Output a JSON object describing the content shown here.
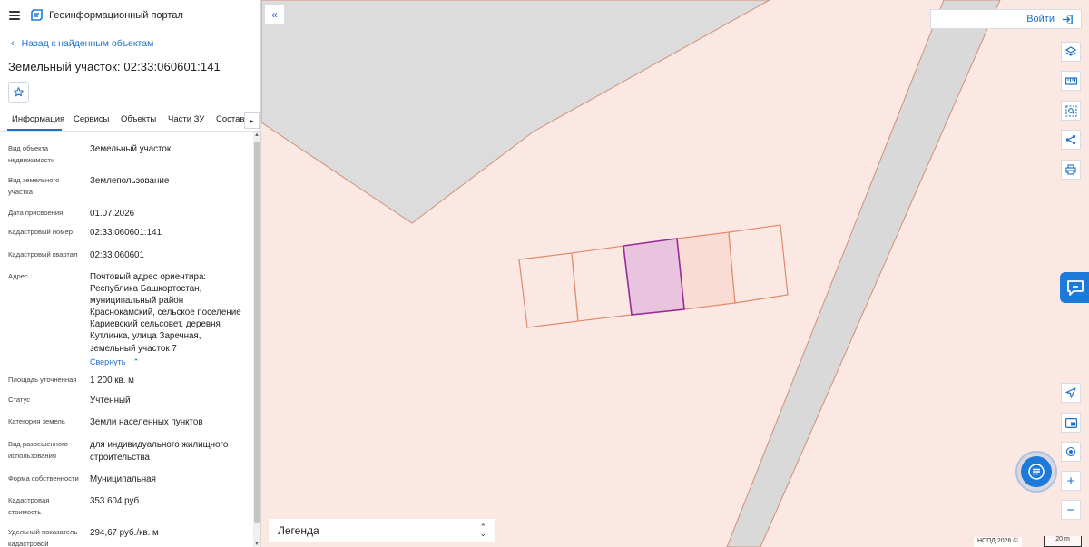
{
  "header": {
    "portal_title": "Геоинформационный портал"
  },
  "nav": {
    "back_label": "Назад к найденным объектам"
  },
  "object": {
    "title": "Земельный участок: 02:33:060601:141"
  },
  "tabs": [
    {
      "label": "Информация",
      "active": true
    },
    {
      "label": "Сервисы"
    },
    {
      "label": "Объекты"
    },
    {
      "label": "Части ЗУ"
    },
    {
      "label": "Состав"
    }
  ],
  "properties": [
    {
      "label": "Вид объекта недвижимости",
      "value": "Земельный участок"
    },
    {
      "label": "Вид земельного участка",
      "value": "Землепользование"
    },
    {
      "label": "Дата присвоения",
      "value": "01.07.2026"
    },
    {
      "label": "Кадастровый номер",
      "value": "02:33:060601:141"
    },
    {
      "label": "Кадастровый квартал",
      "value": "02:33:060601"
    },
    {
      "label": "Адрес",
      "value": "Почтовый адрес ориентира: Республика Башкортостан, муниципальный район Краснокамский, сельское поселение Кариевский сельсовет, деревня Кутлинка, улица Заречная, земельный участок 7",
      "link": "Свернуть"
    },
    {
      "label": "Площадь уточненная",
      "value": "1 200 кв. м"
    },
    {
      "label": "Статус",
      "value": "Учтенный"
    },
    {
      "label": "Категория земель",
      "value": "Земли населенных пунктов"
    },
    {
      "label": "Вид разрешенного использования",
      "value": "для индивидуального жилищного строительства"
    },
    {
      "label": "Форма собственности",
      "value": "Муниципальная"
    },
    {
      "label": "Кадастровая стоимость",
      "value": "353 604 руб."
    },
    {
      "label": "Удельный показатель кадастровой",
      "value": "294,67 руб./кв. м"
    }
  ],
  "map": {
    "login_label": "Войти",
    "legend_label": "Легенда",
    "attribution": "НСПД 2026 ©",
    "scale_label": "20 m",
    "colors": {
      "accent": "#1d7ad9",
      "parcel_fill": "#fbe8e3",
      "parcel_stroke": "#e08a6c",
      "selected_fill": "#e9c4de",
      "selected_stroke": "#9b2a9a",
      "road": "#d9d9d9"
    },
    "tools_top": [
      "layers-icon",
      "ruler-icon",
      "select-area-icon",
      "share-icon",
      "print-icon"
    ],
    "tools_bottom": [
      "locate-icon",
      "map-type-icon",
      "geolocation-icon",
      "zoom-in-icon",
      "zoom-out-icon"
    ]
  }
}
